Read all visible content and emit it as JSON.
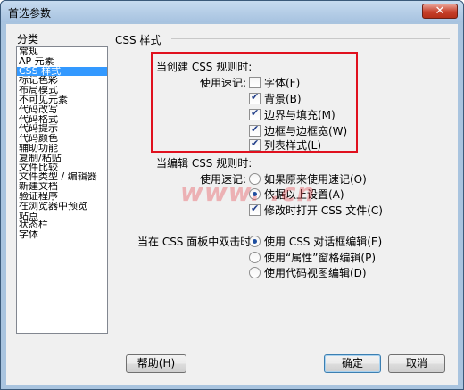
{
  "window": {
    "title": "首选参数",
    "close_glyph": "✕"
  },
  "category": {
    "label": "分类",
    "items": [
      "常规",
      "AP 元素",
      "CSS 样式",
      "标记色彩",
      "布局模式",
      "不可见元素",
      "代码改写",
      "代码格式",
      "代码提示",
      "代码颜色",
      "辅助功能",
      "复制/粘贴",
      "文件比较",
      "文件类型 / 编辑器",
      "新建文档",
      "验证程序",
      "在浏览器中预览",
      "站点",
      "状态栏",
      "字体"
    ],
    "selected_index": 2
  },
  "section": {
    "title": "CSS 样式"
  },
  "create": {
    "heading": "当创建 CSS 规则时:",
    "shorthand_label": "使用速记:",
    "options": [
      {
        "label": "字体(F)",
        "checked": false
      },
      {
        "label": "背景(B)",
        "checked": true
      },
      {
        "label": "边界与填充(M)",
        "checked": true
      },
      {
        "label": "边框与边框宽(W)",
        "checked": true
      },
      {
        "label": "列表样式(L)",
        "checked": true
      }
    ]
  },
  "edit": {
    "heading": "当编辑 CSS 规则时:",
    "shorthand_label": "使用速记:",
    "radio1": {
      "label": "如果原来使用速记(O)",
      "checked": false
    },
    "radio2": {
      "label": "依据以上设置(A)",
      "checked": true
    },
    "checkbox": {
      "label": "修改时打开 CSS 文件(C)",
      "checked": true
    }
  },
  "dblclick": {
    "label": "当在 CSS 面板中双击时:",
    "options": [
      {
        "label": "使用 CSS 对话框编辑(E)",
        "checked": true
      },
      {
        "label": "使用“属性”窗格编辑(P)",
        "checked": false
      },
      {
        "label": "使用代码视图编辑(D)",
        "checked": false
      }
    ]
  },
  "watermark": "www.  .cn",
  "buttons": {
    "help": "帮助(H)",
    "ok": "确定",
    "cancel": "取消"
  }
}
